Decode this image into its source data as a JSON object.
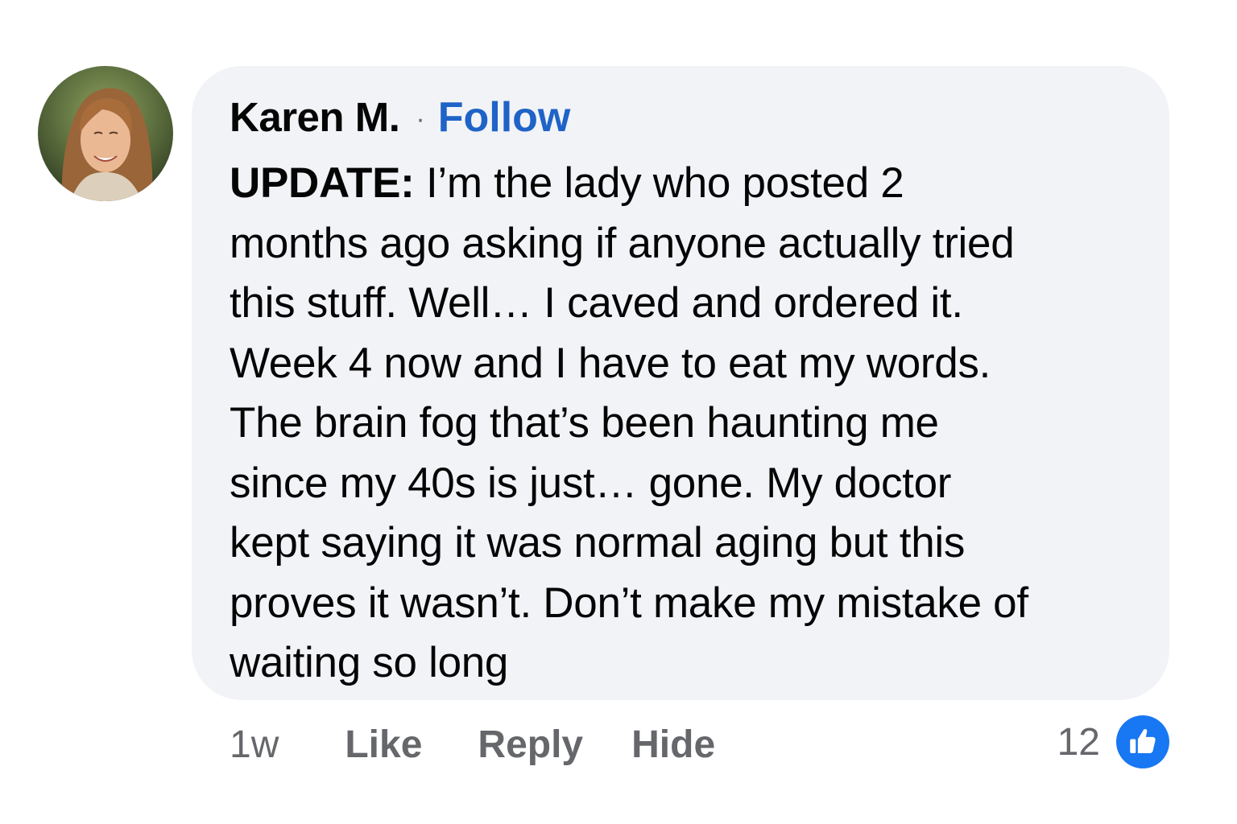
{
  "comment": {
    "author": "Karen M.",
    "separator": "·",
    "follow_label": "Follow",
    "update_label": "UPDATE:",
    "text_lines": [
      " I’m the lady who posted 2",
      "months ago asking if anyone actually tried",
      "this stuff. Well… I caved and ordered it.",
      "Week 4 now and I have to eat my words.",
      "The brain fog that’s been haunting me",
      "since my 40s is just… gone. My doctor",
      "kept saying it was normal aging but this",
      "proves it wasn’t. Don’t make my mistake of",
      "waiting so long"
    ],
    "avatar_icon": "profile-photo"
  },
  "actions": {
    "timestamp": "1w",
    "like_label": "Like",
    "reply_label": "Reply",
    "hide_label": "Hide"
  },
  "reactions": {
    "count": "12",
    "icon": "thumbs-up-icon"
  },
  "colors": {
    "bubble_bg": "#f2f3f7",
    "link": "#1f63c7",
    "secondary_text": "#65676b",
    "like_blue": "#1877f2"
  }
}
